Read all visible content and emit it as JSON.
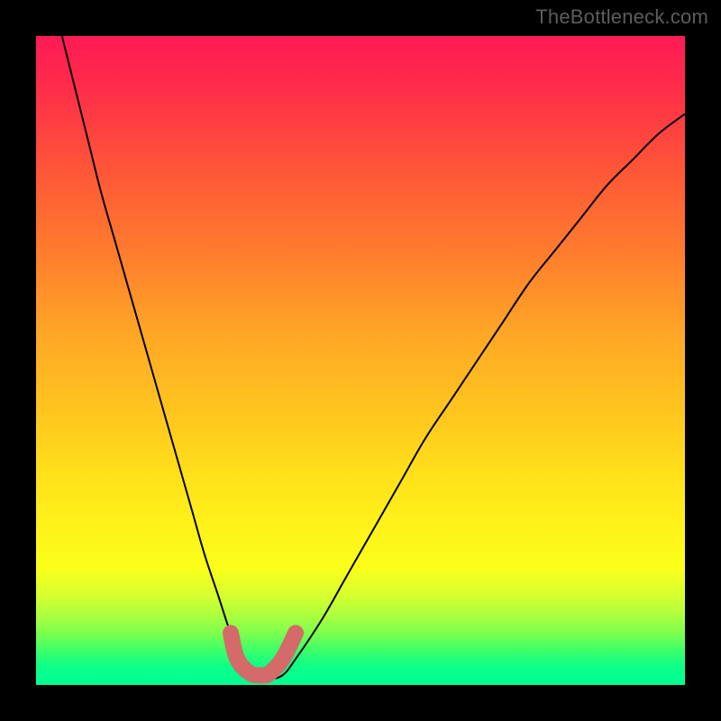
{
  "watermark": "TheBottleneck.com",
  "chart_data": {
    "type": "line",
    "title": "",
    "xlabel": "",
    "ylabel": "",
    "xlim": [
      0,
      100
    ],
    "ylim": [
      0,
      100
    ],
    "series": [
      {
        "name": "bottleneck-curve",
        "x": [
          4,
          6,
          8,
          10,
          12,
          14,
          16,
          18,
          20,
          22,
          24,
          26,
          28,
          30,
          32,
          34,
          36,
          38,
          40,
          44,
          48,
          52,
          56,
          60,
          64,
          68,
          72,
          76,
          80,
          84,
          88,
          92,
          96,
          100
        ],
        "y": [
          100,
          92,
          84,
          76,
          69,
          62,
          55,
          48,
          41,
          34,
          27,
          20,
          14,
          8,
          4,
          1.5,
          1,
          1.5,
          4,
          10,
          17,
          24,
          31,
          38,
          44,
          50,
          56,
          62,
          67,
          72,
          77,
          81,
          85,
          88
        ]
      },
      {
        "name": "bottom-mark",
        "x": [
          30,
          31,
          33,
          35,
          36,
          38,
          40
        ],
        "y": [
          8,
          4,
          1.8,
          1.5,
          1.8,
          4,
          8
        ]
      }
    ],
    "gradient_stops": [
      {
        "pos": 0,
        "color": "#ff1a55"
      },
      {
        "pos": 22,
        "color": "#ff5a36"
      },
      {
        "pos": 46,
        "color": "#ffa726"
      },
      {
        "pos": 68,
        "color": "#ffe11a"
      },
      {
        "pos": 86,
        "color": "#d8ff2e"
      },
      {
        "pos": 100,
        "color": "#00ff93"
      }
    ]
  }
}
